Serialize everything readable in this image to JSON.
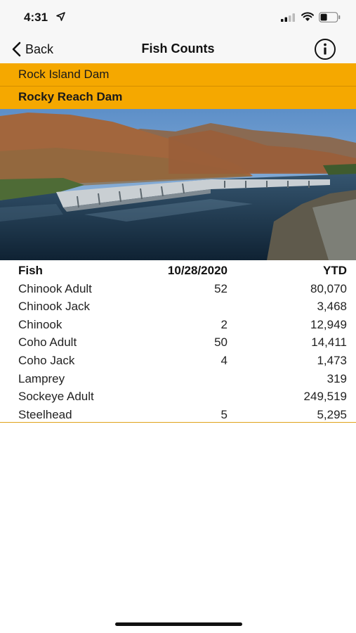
{
  "status_bar": {
    "time": "4:31",
    "icons": [
      "location-arrow-icon",
      "cellular-signal-icon",
      "wifi-icon",
      "battery-icon"
    ]
  },
  "nav": {
    "back_label": "Back",
    "title": "Fish Counts",
    "info_icon": "info-icon"
  },
  "dams": [
    {
      "name": "Rock Island Dam",
      "selected": false
    },
    {
      "name": "Rocky Reach Dam",
      "selected": true
    }
  ],
  "table": {
    "headers": {
      "fish": "Fish",
      "date": "10/28/2020",
      "ytd": "YTD"
    },
    "rows": [
      {
        "fish": "Chinook Adult",
        "today": "52",
        "ytd": "80,070"
      },
      {
        "fish": "Chinook Jack",
        "today": "",
        "ytd": "3,468"
      },
      {
        "fish": "Chinook",
        "today": "2",
        "ytd": "12,949"
      },
      {
        "fish": "Coho Adult",
        "today": "50",
        "ytd": "14,411"
      },
      {
        "fish": "Coho Jack",
        "today": "4",
        "ytd": "1,473"
      },
      {
        "fish": "Lamprey",
        "today": "",
        "ytd": "319"
      },
      {
        "fish": "Sockeye Adult",
        "today": "",
        "ytd": "249,519"
      },
      {
        "fish": "Steelhead",
        "today": "5",
        "ytd": "5,295"
      }
    ]
  },
  "colors": {
    "accent": "#f5a800",
    "background": "#ffffff",
    "bar_background": "#f7f7f7"
  }
}
